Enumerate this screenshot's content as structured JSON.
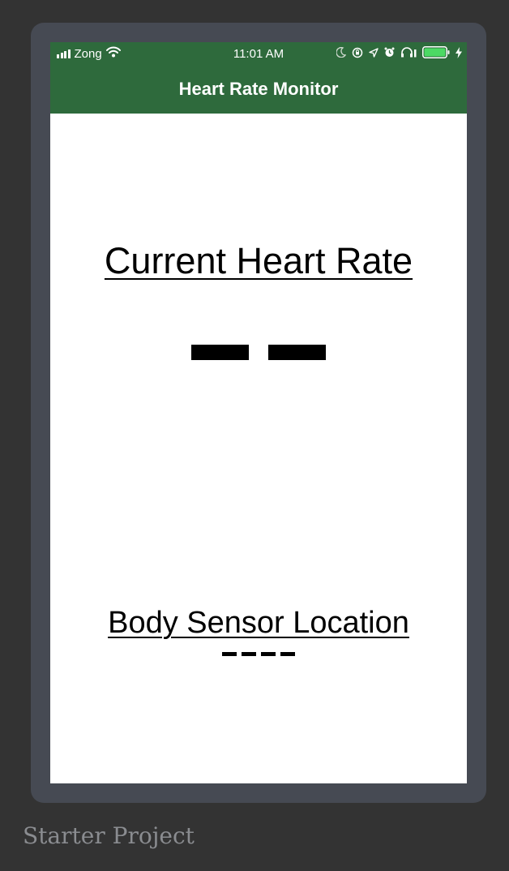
{
  "status_bar": {
    "carrier": "Zong",
    "time": "11:01 AM",
    "icons": [
      "signal-icon",
      "wifi-icon",
      "moon-icon",
      "orientation-lock-icon",
      "location-icon",
      "alarm-icon",
      "headphones-icon",
      "battery-icon",
      "charging-icon"
    ]
  },
  "nav": {
    "title": "Heart Rate Monitor"
  },
  "heart_rate": {
    "label": "Current Heart Rate",
    "value": "– –"
  },
  "sensor": {
    "label": "Body Sensor Location",
    "value": "----"
  },
  "caption": "Starter Project",
  "colors": {
    "background": "#333333",
    "device_frame": "#464a53",
    "navbar": "#2e6a3c",
    "screen": "#ffffff",
    "text": "#000000",
    "caption": "#8a8c90"
  }
}
